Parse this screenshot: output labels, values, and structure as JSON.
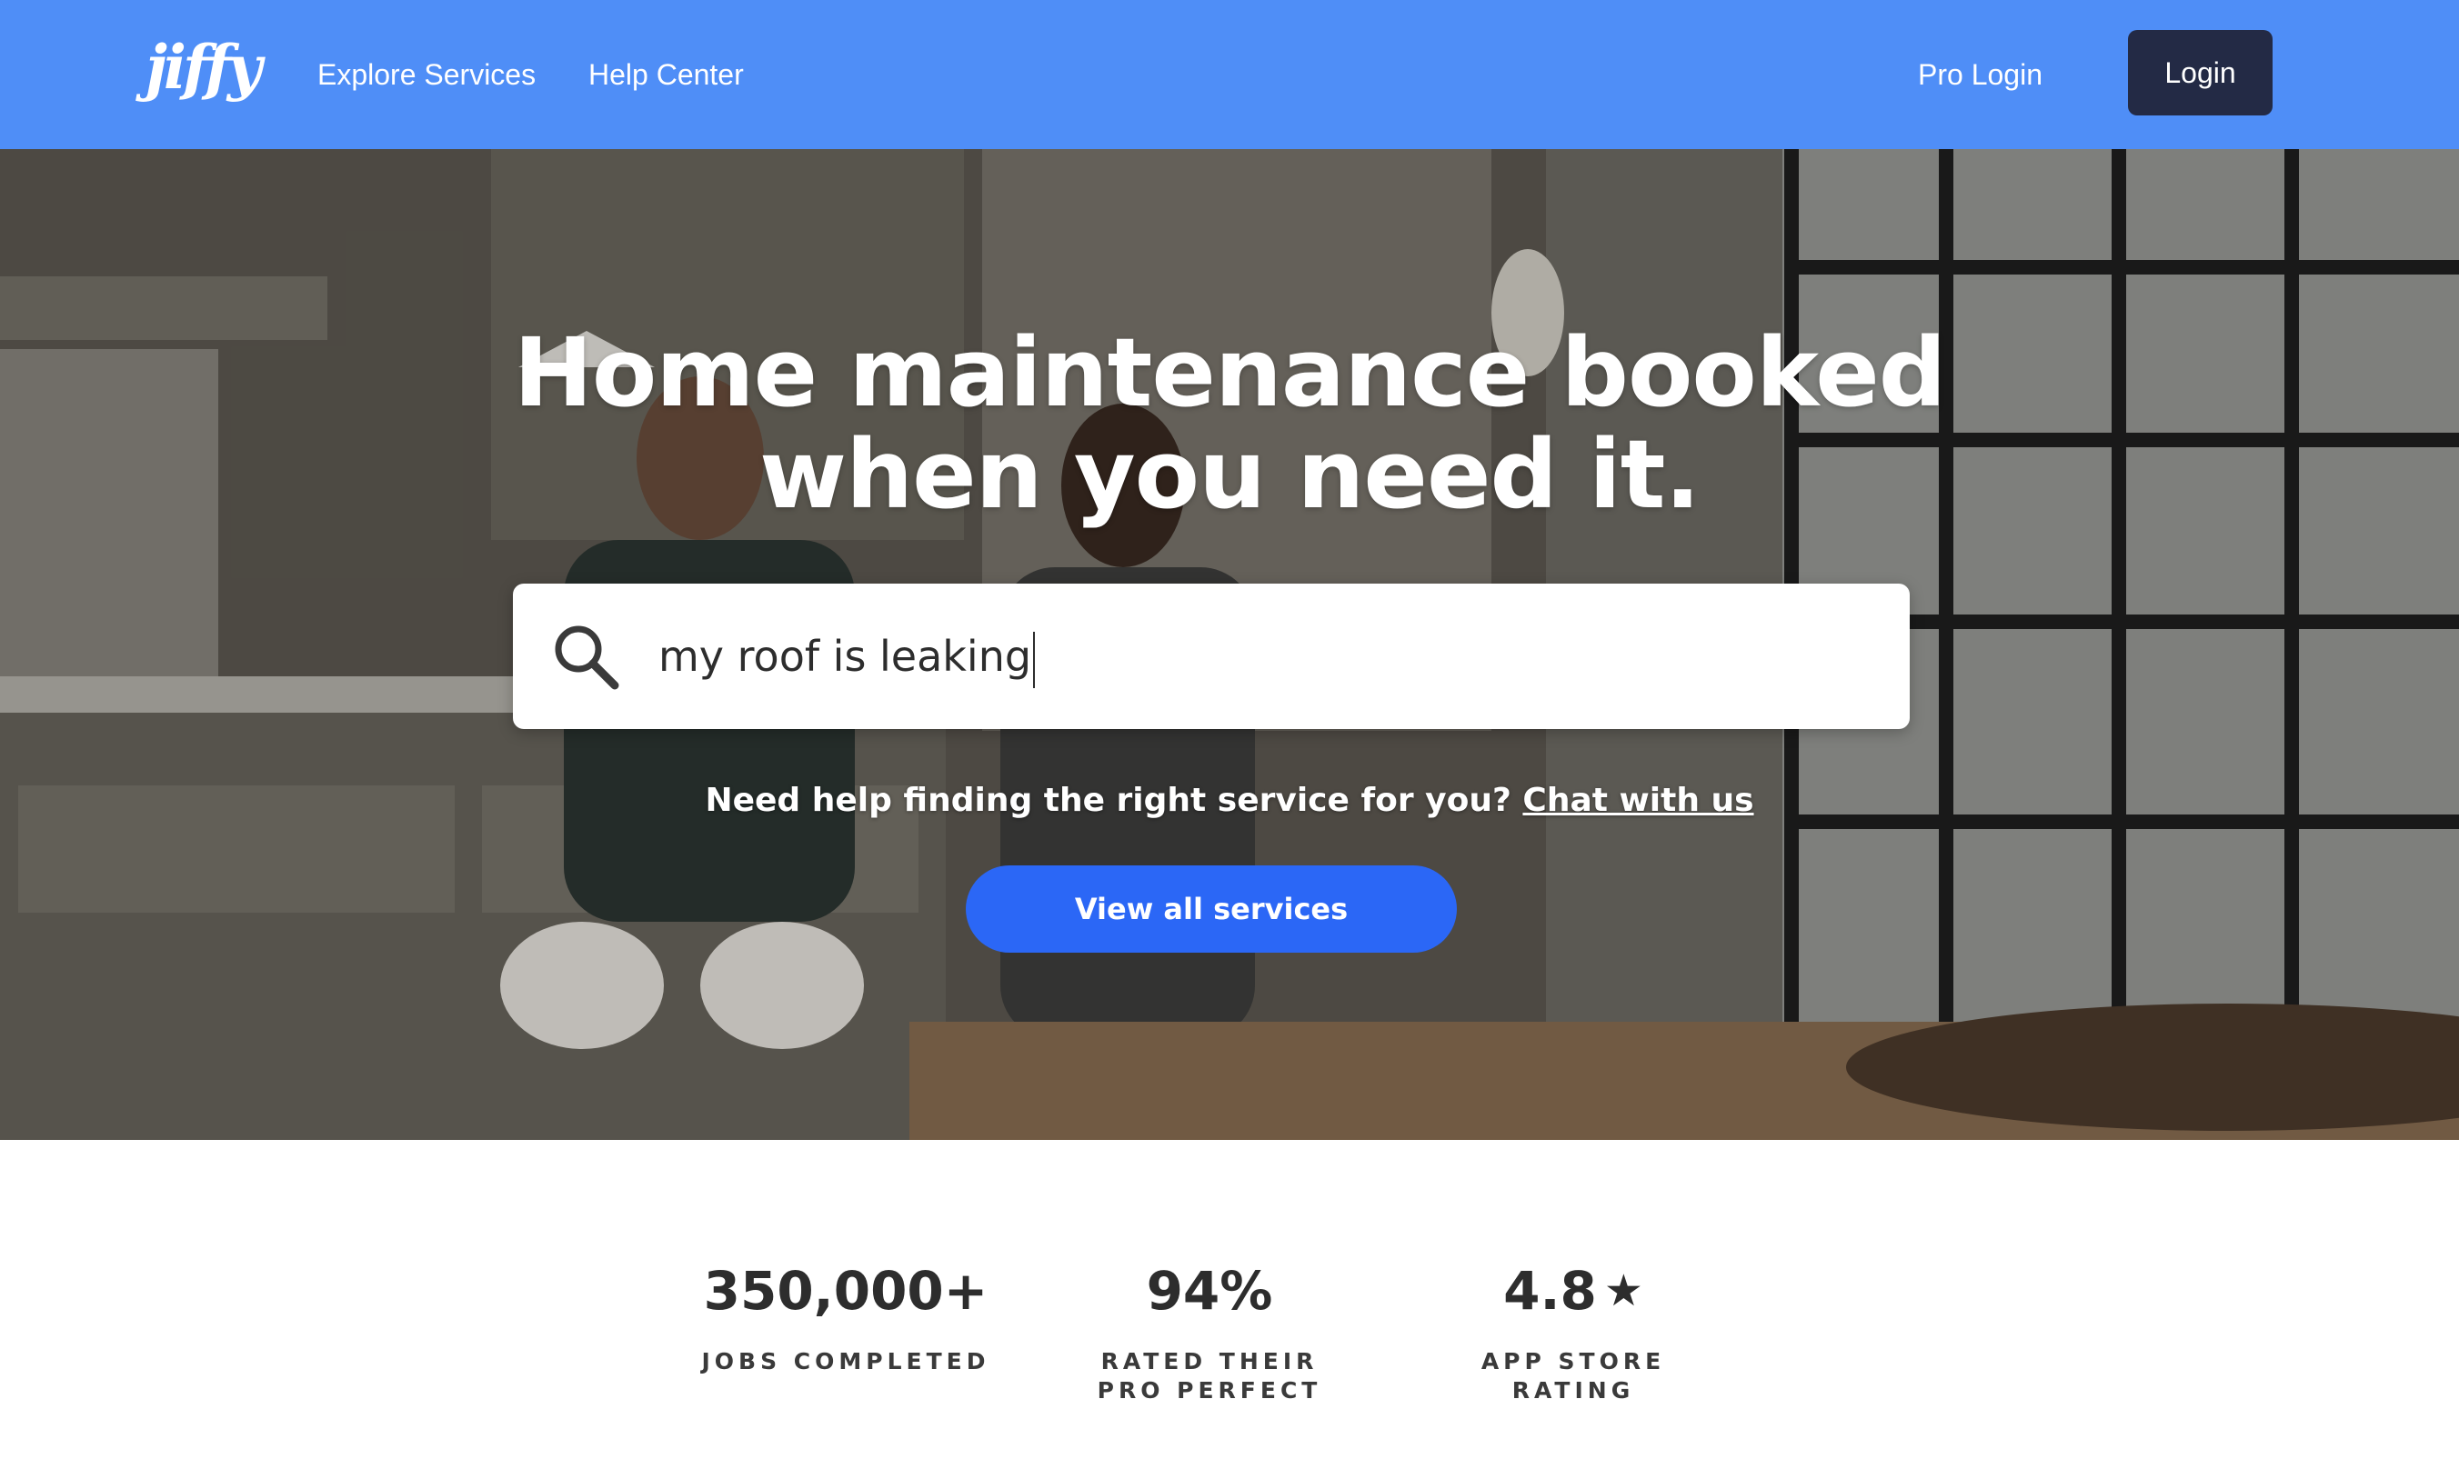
{
  "header": {
    "logo_text": "jiffy",
    "nav": {
      "explore_services": "Explore Services",
      "help_center": "Help Center",
      "pro_login": "Pro Login"
    },
    "login_label": "Login",
    "background_color": "#4f8ef7",
    "login_button_color": "#232a45"
  },
  "hero": {
    "headline_line1": "Home maintenance booked",
    "headline_line2": "when you need it.",
    "search": {
      "icon": "search-icon",
      "value": "my roof is leaking"
    },
    "help_text": "Need help finding the right service for you?",
    "chat_link": "Chat with us",
    "view_all_label": "View all services",
    "button_color": "#2b67f6"
  },
  "stats": [
    {
      "value": "350,000+",
      "label": "JOBS COMPLETED"
    },
    {
      "value": "94%",
      "label": "RATED THEIR PRO PERFECT"
    },
    {
      "value": "4.8",
      "icon": "star-icon",
      "label": "APP STORE RATING"
    }
  ]
}
